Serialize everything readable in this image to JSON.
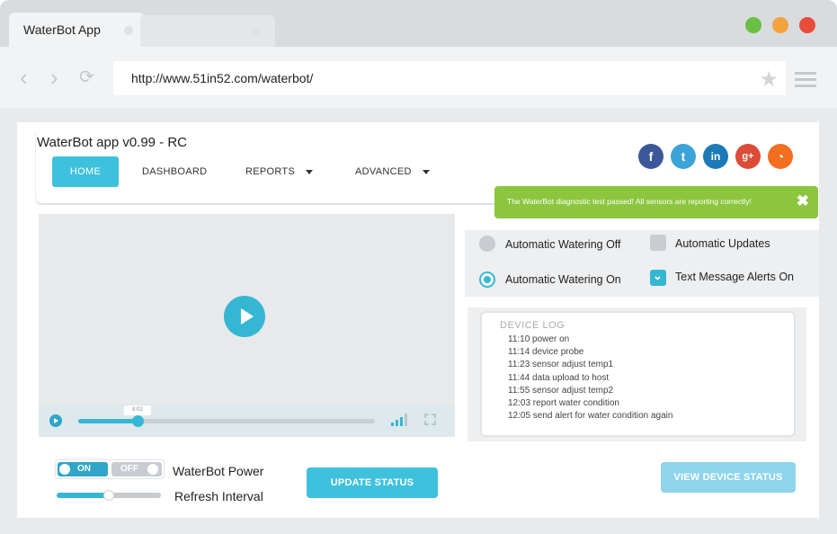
{
  "browser": {
    "tab_title": "WaterBot App",
    "url": "http://www.51in52.com/waterbot/",
    "colors": {
      "close": "#e84c3d",
      "minimize": "#f4a33d",
      "maximize": "#6cbf45"
    }
  },
  "app": {
    "title": "WaterBot app v0.99 - RC",
    "nav": [
      {
        "label": "HOME",
        "active": true
      },
      {
        "label": "DASHBOARD"
      },
      {
        "label": "REPORTS",
        "dropdown": true
      },
      {
        "label": "ADVANCED",
        "dropdown": true
      }
    ],
    "social": [
      {
        "icon": "facebook-icon",
        "glyph": "f",
        "color": "#3b5998"
      },
      {
        "icon": "twitter-icon",
        "glyph": "t",
        "color": "#3ba3d8"
      },
      {
        "icon": "linkedin-icon",
        "glyph": "in",
        "color": "#1b7ab7"
      },
      {
        "icon": "google-plus-icon",
        "glyph": "g+",
        "color": "#dd4b39"
      },
      {
        "icon": "rss-icon",
        "glyph": "◔",
        "color": "#f26f21"
      }
    ],
    "accent": "#3ec1dd",
    "alert": {
      "text": "The WaterBot diagnostic test passed! All sensors are reporting correctly!",
      "close": "✖",
      "color": "#8cc63f"
    },
    "video": {
      "time": "8:02",
      "progress": 0.2
    },
    "options": {
      "watering_off": "Automatic Watering Off",
      "watering_on": "Automatic Watering On",
      "auto_updates": "Automatic Updates",
      "text_alerts": "Text Message Alerts On",
      "watering_selected": "on",
      "auto_updates_checked": false,
      "text_alerts_checked": true
    },
    "device_log": {
      "title": "DEVICE LOG",
      "entries": [
        "11:10 power on",
        "11:14 device probe",
        "11:23 sensor adjust temp1",
        "11:44 data upload to host",
        "11:55 sensor adjust temp2",
        "12:03 report water condition",
        "12:05 send alert for water condition again"
      ]
    },
    "controls": {
      "toggle_on": "ON",
      "toggle_off": "OFF",
      "power_label": "WaterBot Power",
      "refresh_label": "Refresh Interval",
      "refresh_value": 0.5,
      "update_button": "UPDATE STATUS",
      "view_button": "VIEW DEVICE STATUS"
    }
  }
}
